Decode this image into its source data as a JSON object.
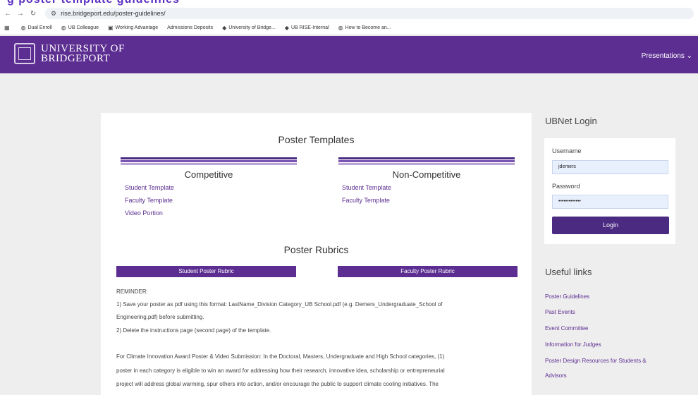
{
  "browser": {
    "top_banner": "g poster template guidelines",
    "url": "rise.bridgeport.edu/poster-guidelines/",
    "bookmarks": [
      "Dual Enroll",
      "UB Colleague",
      "Working Advantage",
      "Admissions Deposits",
      "University of Bridge...",
      "UB RISE-Internal",
      "How to Become an..."
    ]
  },
  "header": {
    "logo_line1": "UNIVERSITY OF",
    "logo_line2": "BRIDGEPORT",
    "nav_presentations": "Presentations"
  },
  "main": {
    "templates_heading": "Poster Templates",
    "competitive": {
      "title": "Competitive",
      "links": [
        "Student Template",
        "Faculty Template",
        "Video Portion"
      ]
    },
    "non_competitive": {
      "title": "Non-Competitive",
      "links": [
        "Student Template",
        "Faculty Template"
      ]
    },
    "rubrics_heading": "Poster Rubrics",
    "rubric_student": "Student Poster Rubric",
    "rubric_faculty": "Faculty Poster Rubric",
    "reminder": "REMINDER:",
    "step1a": "1) Save your poster as pdf using this format:  LastName_Division Category_UB School.pdf (e.g. Demers_Undergraduate_School of",
    "step1b": "Engineering.pdf) before submitting.",
    "step2": "2) Delete the instructions page (second page) of the template.",
    "climate1": "For Climate Innovation Award Poster & Video Submission: In the Doctoral, Masters, Undergraduate and High School categories, (1)",
    "climate2": "poster in each category is eligible to win an award for addressing how their research, innovative idea, scholarship or entrepreneurial",
    "climate3": "project will address global warming, spur others into action, and/or encourage the public to support climate cooling initiatives. The"
  },
  "login": {
    "heading": "UBNet Login",
    "username_label": "Username",
    "username_value": "jdemers",
    "password_label": "Password",
    "password_value": "•••••••••••••",
    "button": "Login"
  },
  "useful_links": {
    "heading": "Useful links",
    "items": [
      "Poster Guidelines",
      "Past Events",
      "Event Committee",
      "Information for Judges",
      "Poster Design Resources for Students &",
      "Advisors"
    ]
  }
}
